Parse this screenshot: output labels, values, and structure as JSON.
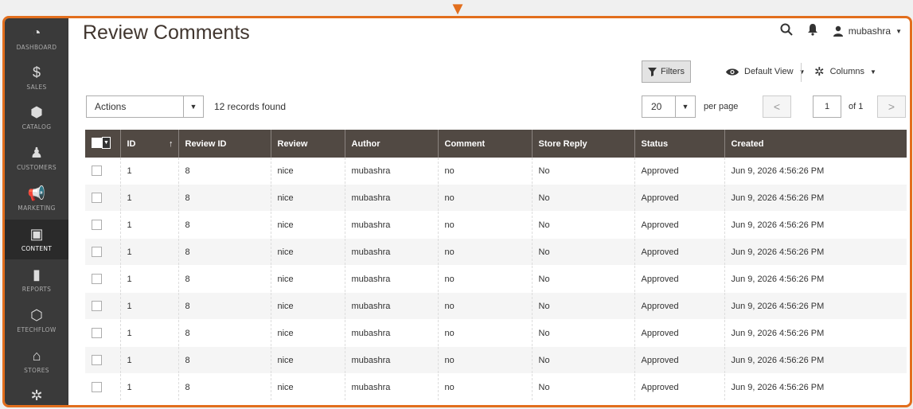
{
  "sidebar": {
    "items": [
      {
        "label": "DASHBOARD",
        "icon": "dashboard-icon",
        "glyph": "◔"
      },
      {
        "label": "SALES",
        "icon": "dollar-icon",
        "glyph": "$"
      },
      {
        "label": "CATALOG",
        "icon": "cube-icon",
        "glyph": "⬢"
      },
      {
        "label": "CUSTOMERS",
        "icon": "person-icon",
        "glyph": "♟"
      },
      {
        "label": "MARKETING",
        "icon": "megaphone-icon",
        "glyph": "📢"
      },
      {
        "label": "CONTENT",
        "icon": "layout-icon",
        "glyph": "▣"
      },
      {
        "label": "REPORTS",
        "icon": "bar-chart-icon",
        "glyph": "▮"
      },
      {
        "label": "ETECHFLOW",
        "icon": "hexagon-icon",
        "glyph": "⬡"
      },
      {
        "label": "STORES",
        "icon": "store-icon",
        "glyph": "⌂"
      },
      {
        "label": "SYSTEM",
        "icon": "gear-icon",
        "glyph": "✲"
      }
    ]
  },
  "header": {
    "title": "Review Comments",
    "user": "mubashra"
  },
  "toolbar": {
    "filters_label": "Filters",
    "view_label": "Default View",
    "columns_label": "Columns",
    "actions_label": "Actions",
    "records_found": "12 records found",
    "per_page_value": "20",
    "per_page_label": "per page",
    "page_current": "1",
    "page_of": "of 1"
  },
  "table": {
    "headers": [
      "ID",
      "Review ID",
      "Review",
      "Author",
      "Comment",
      "Store Reply",
      "Status",
      "Created"
    ],
    "rows": [
      [
        "1",
        "8",
        "nice",
        "mubashra",
        "no",
        "No",
        "Approved",
        "Jun 9, 2026 4:56:26 PM"
      ],
      [
        "1",
        "8",
        "nice",
        "mubashra",
        "no",
        "No",
        "Approved",
        "Jun 9, 2026 4:56:26 PM"
      ],
      [
        "1",
        "8",
        "nice",
        "mubashra",
        "no",
        "No",
        "Approved",
        "Jun 9, 2026 4:56:26 PM"
      ],
      [
        "1",
        "8",
        "nice",
        "mubashra",
        "no",
        "No",
        "Approved",
        "Jun 9, 2026 4:56:26 PM"
      ],
      [
        "1",
        "8",
        "nice",
        "mubashra",
        "no",
        "No",
        "Approved",
        "Jun 9, 2026 4:56:26 PM"
      ],
      [
        "1",
        "8",
        "nice",
        "mubashra",
        "no",
        "No",
        "Approved",
        "Jun 9, 2026 4:56:26 PM"
      ],
      [
        "1",
        "8",
        "nice",
        "mubashra",
        "no",
        "No",
        "Approved",
        "Jun 9, 2026 4:56:26 PM"
      ],
      [
        "1",
        "8",
        "nice",
        "mubashra",
        "no",
        "No",
        "Approved",
        "Jun 9, 2026 4:56:26 PM"
      ],
      [
        "1",
        "8",
        "nice",
        "mubashra",
        "no",
        "No",
        "Approved",
        "Jun 9, 2026 4:56:26 PM"
      ]
    ]
  },
  "colors": {
    "sidebar_bg": "#3a3a3a",
    "header_bg": "#514943",
    "accent_frame": "#e26e1d"
  }
}
